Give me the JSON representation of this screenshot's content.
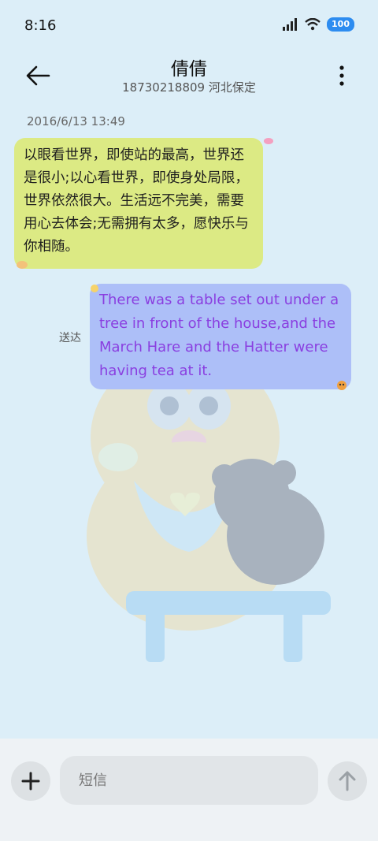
{
  "status_bar": {
    "time": "8:16",
    "battery": "100",
    "icons": [
      "signal-icon",
      "wifi-icon",
      "battery-icon"
    ]
  },
  "header": {
    "contact_name": "倩倩",
    "contact_subtitle": "18730218809 河北保定",
    "icons": [
      "back-arrow-icon",
      "more-vertical-icon"
    ]
  },
  "conversation": {
    "timestamp": "2016/6/13 13:49",
    "incoming_message": "以眼看世界，即使站的最高，世界还是很小;以心看世界，即使身处局限，世界依然很大。生活远不完美，需要用心去体会;无需拥有太多，愿快乐与你相随。",
    "outgoing_message": "There was a table set out under a tree in front of the house,and the March Hare and the Hatter were having tea at it.",
    "outgoing_status": "送达"
  },
  "composer": {
    "placeholder": "短信",
    "value": "",
    "icons": [
      "plus-icon",
      "send-arrow-icon"
    ]
  },
  "colors": {
    "background": "#dceef8",
    "incoming_bubble": "#dcea84",
    "outgoing_bubble": "#adbff8",
    "outgoing_text": "#8a3fe0",
    "battery": "#2d8cf0"
  }
}
